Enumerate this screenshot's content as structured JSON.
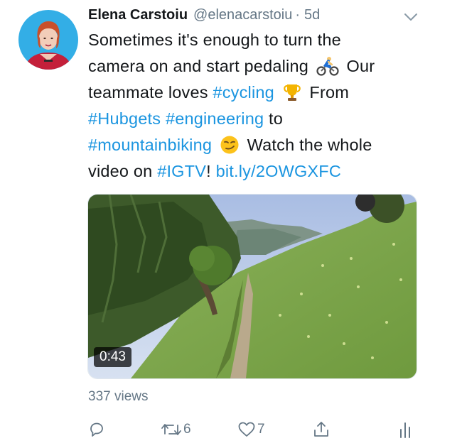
{
  "author": {
    "name": "Elena Carstoiu",
    "handle": "@elenacarstoiu",
    "separator": "·",
    "timestamp": "5d"
  },
  "tweet": {
    "line1": "Sometimes it's enough to turn the",
    "line2_a": "camera on and start pedaling",
    "line2_emoji": "cyclist-emoji",
    "line2_b": "Our",
    "line3_a": "teammate loves",
    "line3_hashtag": "#cycling",
    "line3_emoji": "trophy-emoji",
    "line3_b": "From",
    "line4_hashtag1": "#Hubgets",
    "line4_hashtag2": "#engineering",
    "line4_b": "to",
    "line5_hashtag": "#mountainbiking",
    "line5_emoji": "smirk-emoji",
    "line5_b": "Watch the whole",
    "line6_a": "video on",
    "line6_hashtag": "#IGTV",
    "line6_b": "!",
    "line6_link": "bit.ly/2OWGXFC"
  },
  "media": {
    "duration": "0:43",
    "description_icon": "video-thumbnail"
  },
  "stats": {
    "views": "337 views"
  },
  "actions": {
    "reply_icon": "reply-icon",
    "retweet_icon": "retweet-icon",
    "retweet_count": "6",
    "like_icon": "heart-icon",
    "like_count": "7",
    "share_icon": "share-icon",
    "analytics_icon": "analytics-icon"
  },
  "colors": {
    "link": "#1b95e0",
    "secondary_text": "#657786",
    "primary_text": "#14171a"
  }
}
